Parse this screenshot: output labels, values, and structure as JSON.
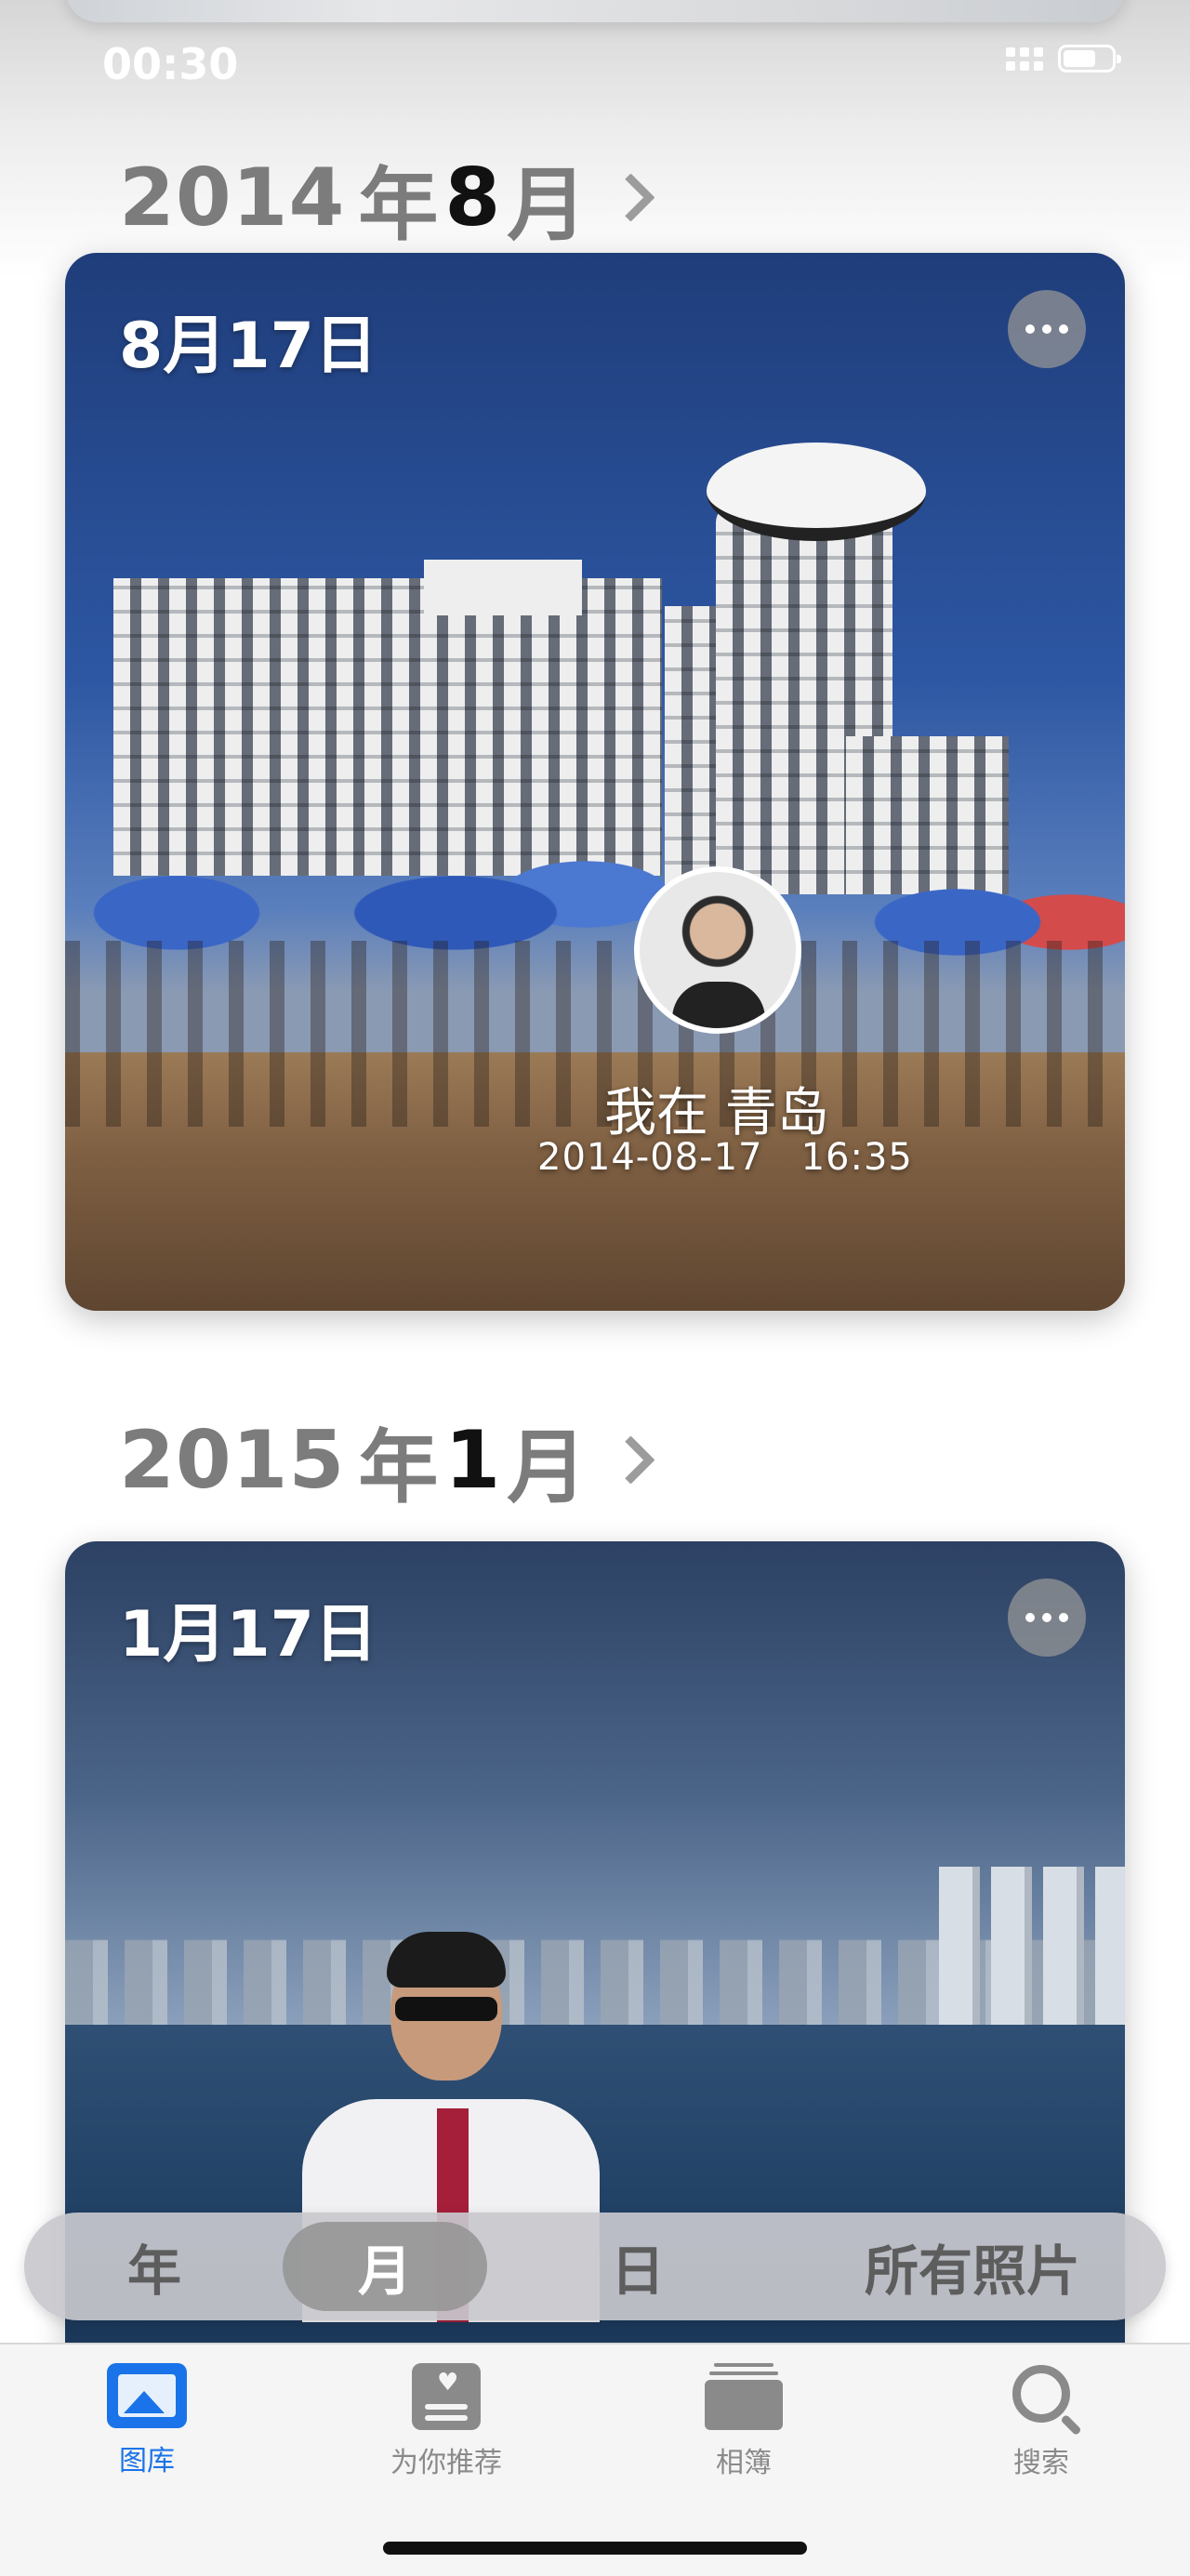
{
  "status_bar": {
    "time": "00:30"
  },
  "sections": [
    {
      "year": "2014",
      "year_suffix": "年",
      "month_num": "8",
      "month_suffix": "月",
      "card": {
        "date": "8月17日",
        "location": "我在 青岛",
        "datetime": "2014-08-17   16:35"
      }
    },
    {
      "year": "2015",
      "year_suffix": "年",
      "month_num": "1",
      "month_suffix": "月",
      "card": {
        "date": "1月17日"
      }
    }
  ],
  "segmented_control": {
    "items": [
      "年",
      "月",
      "日",
      "所有照片"
    ],
    "selected": "月"
  },
  "tab_bar": {
    "items": [
      {
        "label": "图库",
        "icon": "photos-icon",
        "active": true
      },
      {
        "label": "为你推荐",
        "icon": "for-you-icon",
        "active": false
      },
      {
        "label": "相簿",
        "icon": "albums-icon",
        "active": false
      },
      {
        "label": "搜索",
        "icon": "search-icon",
        "active": false
      }
    ]
  },
  "colors": {
    "accent": "#1a73e8",
    "header_gray": "#7c7c7c"
  }
}
